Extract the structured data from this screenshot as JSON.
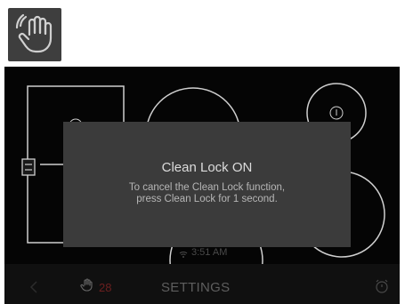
{
  "icon_button": {
    "icon": "clean-lock-hand-icon"
  },
  "status": {
    "time": "3:51 AM"
  },
  "bottom_bar": {
    "lock_count": "28",
    "settings_label": "SETTINGS",
    "lock_icon": "clean-lock-hand-icon",
    "timer_icon": "timer-icon",
    "back_icon": "chevron-left-icon"
  },
  "popup": {
    "title": "Clean Lock ON",
    "line1": "To cancel the Clean Lock function,",
    "line2": "press Clean Lock for 1 second."
  },
  "colors": {
    "background": "#050505",
    "popup": "#3b3b3b",
    "burner_outline": "#cfcfcf",
    "lock_count": "#6b1f1f"
  }
}
